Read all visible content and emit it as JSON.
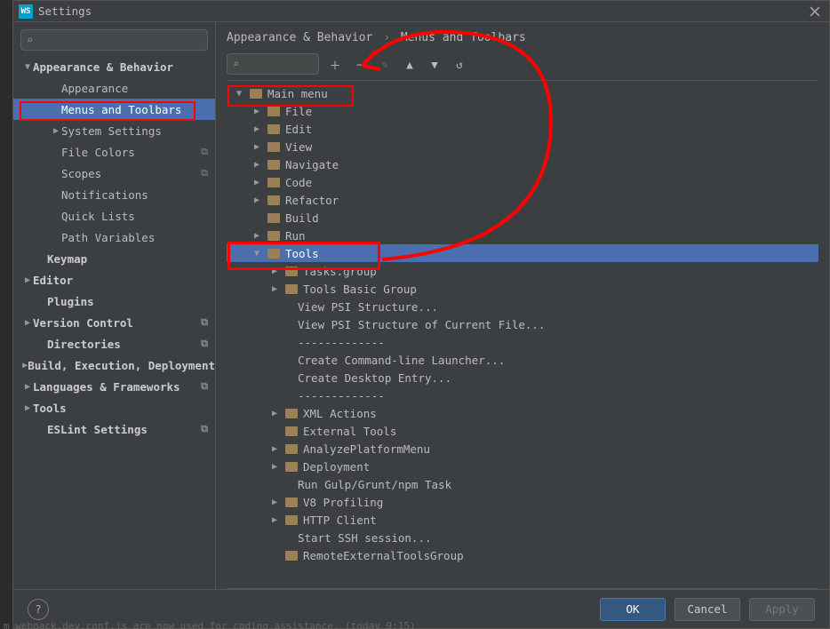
{
  "title": "Settings",
  "breadcrumb": {
    "a": "Appearance & Behavior",
    "b": "Menus and Toolbars"
  },
  "sidebar": {
    "items": [
      {
        "label": "Appearance & Behavior",
        "bold": true,
        "arrow": "down"
      },
      {
        "label": "Appearance",
        "lvl": 2
      },
      {
        "label": "Menus and Toolbars",
        "lvl": 2,
        "selected": true
      },
      {
        "label": "System Settings",
        "lvl": 2,
        "arrow": "right"
      },
      {
        "label": "File Colors",
        "lvl": 2,
        "gear": true
      },
      {
        "label": "Scopes",
        "lvl": 2,
        "gear": true
      },
      {
        "label": "Notifications",
        "lvl": 2
      },
      {
        "label": "Quick Lists",
        "lvl": 2
      },
      {
        "label": "Path Variables",
        "lvl": 2
      },
      {
        "label": "Keymap",
        "bold": true,
        "lvl": 1
      },
      {
        "label": "Editor",
        "bold": true,
        "arrow": "right"
      },
      {
        "label": "Plugins",
        "bold": true,
        "lvl": 1
      },
      {
        "label": "Version Control",
        "bold": true,
        "arrow": "right",
        "gear": true
      },
      {
        "label": "Directories",
        "bold": true,
        "lvl": 1,
        "gear": true
      },
      {
        "label": "Build, Execution, Deployment",
        "bold": true,
        "arrow": "right"
      },
      {
        "label": "Languages & Frameworks",
        "bold": true,
        "arrow": "right",
        "gear": true
      },
      {
        "label": "Tools",
        "bold": true,
        "arrow": "right"
      },
      {
        "label": "ESLint Settings",
        "bold": true,
        "lvl": 1,
        "gear": true
      }
    ]
  },
  "mainTree": [
    {
      "label": "Main menu",
      "lvl": 0,
      "arrow": "down",
      "folder": true
    },
    {
      "label": "File",
      "lvl": 1,
      "arrow": "right",
      "folder": true
    },
    {
      "label": "Edit",
      "lvl": 1,
      "arrow": "right",
      "folder": true
    },
    {
      "label": "View",
      "lvl": 1,
      "arrow": "right",
      "folder": true
    },
    {
      "label": "Navigate",
      "lvl": 1,
      "arrow": "right",
      "folder": true
    },
    {
      "label": "Code",
      "lvl": 1,
      "arrow": "right",
      "folder": true
    },
    {
      "label": "Refactor",
      "lvl": 1,
      "arrow": "right",
      "folder": true
    },
    {
      "label": "Build",
      "lvl": 1,
      "arrow": "none",
      "folder": true
    },
    {
      "label": "Run",
      "lvl": 1,
      "arrow": "right",
      "folder": true
    },
    {
      "label": "Tools",
      "lvl": 1,
      "arrow": "down",
      "folder": true,
      "selected": true
    },
    {
      "label": "Tasks.group",
      "lvl": 2,
      "arrow": "right",
      "folder": true
    },
    {
      "label": "Tools Basic Group",
      "lvl": 2,
      "arrow": "right",
      "folder": true
    },
    {
      "label": "View PSI Structure...",
      "lvl": 2,
      "arrow": "none"
    },
    {
      "label": "View PSI Structure of Current File...",
      "lvl": 2,
      "arrow": "none"
    },
    {
      "label": "-------------",
      "lvl": 2,
      "arrow": "none"
    },
    {
      "label": "Create Command-line Launcher...",
      "lvl": 2,
      "arrow": "none"
    },
    {
      "label": "Create Desktop Entry...",
      "lvl": 2,
      "arrow": "none"
    },
    {
      "label": "-------------",
      "lvl": 2,
      "arrow": "none"
    },
    {
      "label": "XML Actions",
      "lvl": 2,
      "arrow": "right",
      "folder": true
    },
    {
      "label": "External Tools",
      "lvl": 2,
      "arrow": "none",
      "folder": true
    },
    {
      "label": "AnalyzePlatformMenu",
      "lvl": 2,
      "arrow": "right",
      "folder": true
    },
    {
      "label": "Deployment",
      "lvl": 2,
      "arrow": "right",
      "folder": true
    },
    {
      "label": "Run Gulp/Grunt/npm Task",
      "lvl": 2,
      "arrow": "none"
    },
    {
      "label": "V8 Profiling",
      "lvl": 2,
      "arrow": "right",
      "folder": true
    },
    {
      "label": "HTTP Client",
      "lvl": 2,
      "arrow": "right",
      "folder": true
    },
    {
      "label": "Start SSH session...",
      "lvl": 2,
      "arrow": "none"
    },
    {
      "label": "RemoteExternalToolsGroup",
      "lvl": 2,
      "arrow": "none",
      "folder": true
    }
  ],
  "buttons": {
    "ok": "OK",
    "cancel": "Cancel",
    "apply": "Apply"
  },
  "status": "m webpack.dev.conf.js are now used for coding assistance. (today 9:15)"
}
